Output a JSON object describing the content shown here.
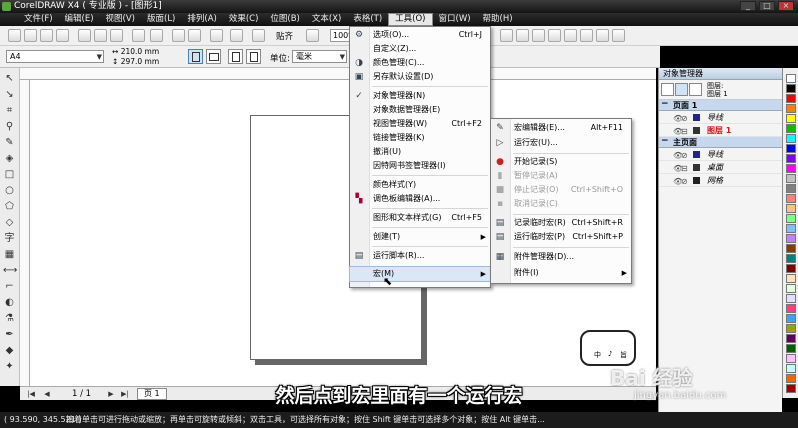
{
  "window": {
    "title": "CorelDRAW X4 ( 专业版 ) - [图形1]"
  },
  "menubar": [
    "文件(F)",
    "编辑(E)",
    "视图(V)",
    "版面(L)",
    "排列(A)",
    "效果(C)",
    "位图(B)",
    "文本(X)",
    "表格(T)",
    "工具(O)",
    "窗口(W)",
    "帮助(H)"
  ],
  "toolbar": {
    "snap_label": "贴齐",
    "zoom": "100%"
  },
  "propertybar": {
    "paper_size": "A4",
    "width": "210.0 mm",
    "height": "297.0 mm",
    "units_label": "单位:",
    "units_value": "毫米"
  },
  "tools_menu": [
    {
      "label": "选项(O)...",
      "shortcut": "Ctrl+J"
    },
    {
      "label": "自定义(Z)..."
    },
    {
      "label": "颜色管理(C)..."
    },
    {
      "label": "另存默认设置(D)"
    },
    {
      "label": "对象管理器(N)"
    },
    {
      "label": "对象数据管理器(E)"
    },
    {
      "label": "视图管理器(W)",
      "shortcut": "Ctrl+F2"
    },
    {
      "label": "链接管理器(K)"
    },
    {
      "label": "撤消(U)"
    },
    {
      "label": "因特网书签管理器(I)"
    },
    {
      "label": "颜色样式(Y)"
    },
    {
      "label": "调色板编辑器(A)..."
    },
    {
      "label": "图形和文本样式(G)",
      "shortcut": "Ctrl+F5"
    },
    {
      "label": "创建(T)"
    },
    {
      "label": "运行脚本(R)..."
    },
    {
      "label": "宏(M)"
    }
  ],
  "macro_submenu": [
    {
      "label": "宏编辑器(E)...",
      "shortcut": "Alt+F11"
    },
    {
      "label": "运行宏(U)..."
    },
    {
      "label": "开始记录(S)"
    },
    {
      "label": "暂停记录(A)"
    },
    {
      "label": "停止记录(O)",
      "shortcut": "Ctrl+Shift+O"
    },
    {
      "label": "取消记录(C)"
    },
    {
      "label": "记录临时宏(R)",
      "shortcut": "Ctrl+Shift+R"
    },
    {
      "label": "运行临时宏(P)",
      "shortcut": "Ctrl+Shift+P"
    },
    {
      "label": "附件管理器(D)..."
    },
    {
      "label": "附件(I)"
    }
  ],
  "docker": {
    "title": "对象管理器",
    "layer_label": "图层:",
    "layer_value": "图层 1",
    "page1": "页面 1",
    "page1_layers": [
      "导线",
      "图层 1"
    ],
    "master": "主页面",
    "master_layers": [
      "导线",
      "桌面",
      "网格"
    ]
  },
  "doodle": [
    "中",
    "♪",
    "旨"
  ],
  "nav": {
    "page_count": "1 / 1",
    "page_tab": "页 1"
  },
  "status": {
    "coords": "( 93.590, 345.521 )",
    "hint": "接着单击可进行拖动或缩放；再单击可旋转或倾斜；双击工具，可选择所有对象；按住 Shift 键单击可选择多个对象；按住 Alt 键单击..."
  },
  "overlay": {
    "subtitle": "然后点到宏里面有一个运行宏",
    "watermark": "Bai 经验",
    "watermark_url": "jingyan.baidu.com"
  },
  "palette_colors": [
    "#ffffff",
    "#000000",
    "#ff0000",
    "#ff8000",
    "#ffff00",
    "#00c000",
    "#00ffff",
    "#0000ff",
    "#8000ff",
    "#ff00ff",
    "#c0c0c0",
    "#808080",
    "#ff8080",
    "#ffc080",
    "#80ff80",
    "#80c0ff",
    "#c080ff",
    "#804000",
    "#008080",
    "#800000",
    "#ffe0c0",
    "#e0ffe0",
    "#e0e0ff",
    "#ff4080",
    "#40a0ff",
    "#a0a000",
    "#600060",
    "#006000",
    "#ffc0ff",
    "#c0ffff",
    "#ff6000",
    "#a00000"
  ]
}
